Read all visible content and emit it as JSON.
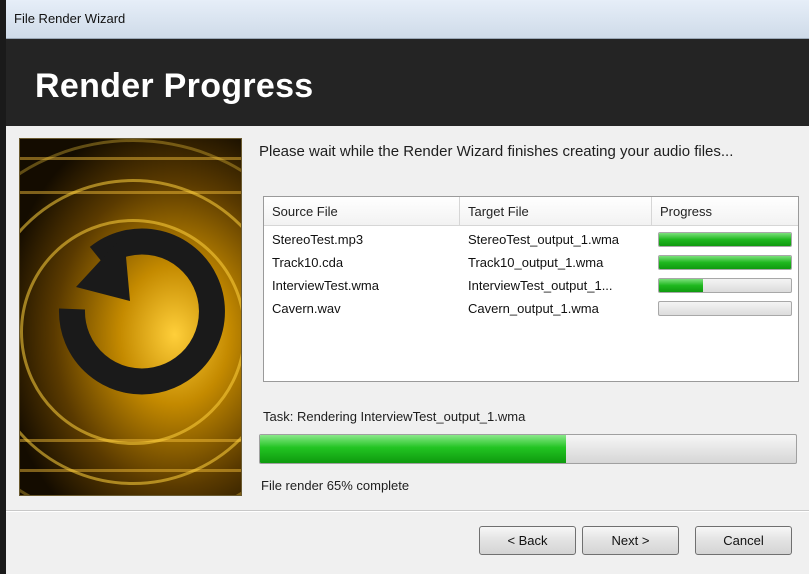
{
  "window": {
    "title": "File Render Wizard"
  },
  "header": {
    "title": "Render Progress"
  },
  "prompt": "Please wait while the Render Wizard finishes creating your audio files...",
  "table": {
    "columns": [
      "Source File",
      "Target File",
      "Progress"
    ],
    "rows": [
      {
        "source": "StereoTest.mp3",
        "target": "StereoTest_output_1.wma",
        "progress": 1.0
      },
      {
        "source": "Track10.cda",
        "target": "Track10_output_1.wma",
        "progress": 1.0
      },
      {
        "source": "InterviewTest.wma",
        "target": "InterviewTest_output_1...",
        "progress": 0.33
      },
      {
        "source": "Cavern.wav",
        "target": "Cavern_output_1.wma",
        "progress": 0.0
      }
    ]
  },
  "task": {
    "label": "Task: Rendering InterviewTest_output_1.wma"
  },
  "overall": {
    "progress": 0.57,
    "status": "File render 65% complete"
  },
  "buttons": {
    "back": "< Back",
    "next": "Next >",
    "cancel": "Cancel"
  },
  "colors": {
    "progress_green": "#1fb81f",
    "header_bg": "#242424",
    "art_gold": "#c48a00"
  },
  "icons": {
    "art": "refresh-arrow-icon"
  }
}
